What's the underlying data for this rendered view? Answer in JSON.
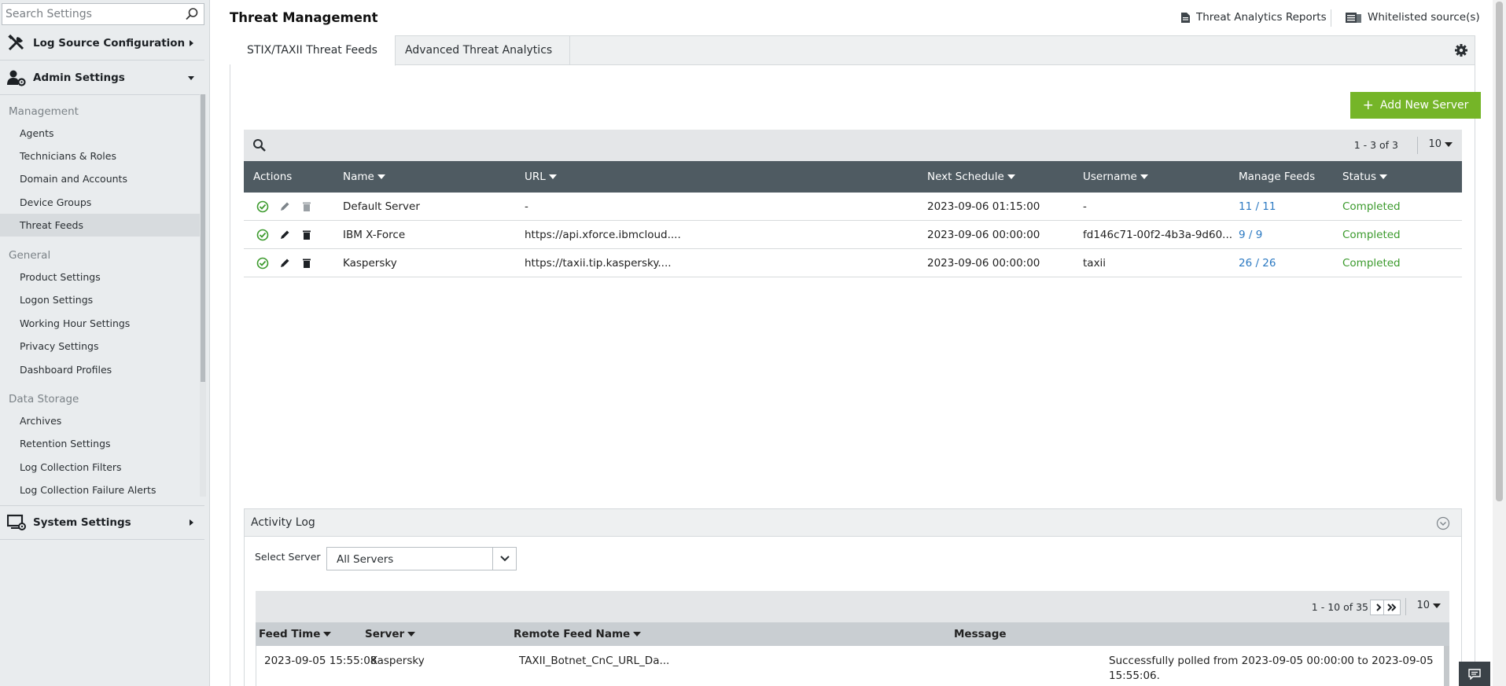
{
  "sidebar": {
    "search_placeholder": "Search Settings",
    "sections": {
      "log_source": "Log Source Configuration",
      "admin": "Admin Settings",
      "system": "System Settings"
    },
    "groups": {
      "management": "Management",
      "general": "General",
      "data_storage": "Data Storage"
    },
    "management_items": [
      "Agents",
      "Technicians & Roles",
      "Domain and Accounts",
      "Device Groups",
      "Threat Feeds"
    ],
    "general_items": [
      "Product Settings",
      "Logon Settings",
      "Working Hour Settings",
      "Privacy Settings",
      "Dashboard Profiles"
    ],
    "data_storage_items": [
      "Archives",
      "Retention Settings",
      "Log Collection Filters",
      "Log Collection Failure Alerts"
    ],
    "active_item": "Threat Feeds"
  },
  "header": {
    "title": "Threat Management",
    "reports_link": "Threat Analytics Reports",
    "whitelist_link": "Whitelisted source(s)"
  },
  "tabs": [
    "STIX/TAXII Threat Feeds",
    "Advanced Threat Analytics"
  ],
  "add_button": "Add New Server",
  "servers_table": {
    "pager": "1 - 3 of 3",
    "per_page": "10",
    "columns": [
      "Actions",
      "Name",
      "URL",
      "Next Schedule",
      "Username",
      "Manage Feeds",
      "Status"
    ],
    "rows": [
      {
        "name": "Default Server",
        "url": "-",
        "next_schedule": "2023-09-06 01:15:00",
        "username": "-",
        "feeds": "11 / 11",
        "status": "Completed"
      },
      {
        "name": "IBM X-Force",
        "url": "https://api.xforce.ibmcloud....",
        "next_schedule": "2023-09-06 00:00:00",
        "username": "fd146c71-00f2-4b3a-9d60...",
        "feeds": "9 / 9",
        "status": "Completed"
      },
      {
        "name": "Kaspersky",
        "url": "https://taxii.tip.kaspersky....",
        "next_schedule": "2023-09-06 00:00:00",
        "username": "taxii",
        "feeds": "26 / 26",
        "status": "Completed"
      }
    ]
  },
  "activity_log": {
    "title": "Activity Log",
    "select_label": "Select Server",
    "select_value": "All Servers",
    "pager": "1 - 10 of 35",
    "per_page": "10",
    "columns": [
      "Feed Time",
      "Server",
      "Remote Feed Name",
      "Message"
    ],
    "rows": [
      {
        "feed_time": "2023-09-05 15:55:08",
        "server": "Kaspersky",
        "feed_name": "TAXII_Botnet_CnC_URL_Da...",
        "message": "Successfully polled from 2023-09-05 00:00:00 to 2023-09-05 15:55:06."
      }
    ]
  },
  "colors": {
    "accent_green": "#75b528",
    "header_dark": "#4f5b62",
    "link_blue": "#2b79c2",
    "status_green": "#3b9a2c"
  }
}
